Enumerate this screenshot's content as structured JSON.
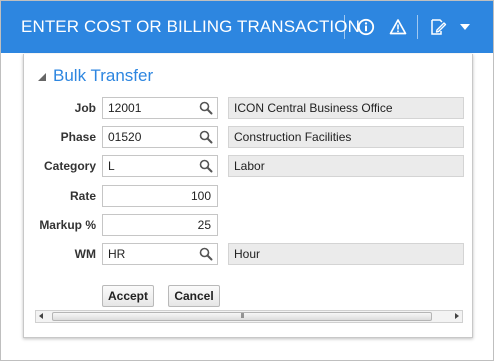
{
  "window": {
    "title": "ENTER COST OR BILLING TRANSACTION",
    "accent_color": "#2d86e0",
    "toolbar_icons": [
      "info-icon",
      "warning-icon",
      "edit-icon",
      "chevron-down-icon"
    ]
  },
  "section": {
    "title": "Bulk Transfer",
    "expanded": true
  },
  "fields": {
    "job": {
      "label": "Job",
      "value": "12001",
      "description": "ICON Central Business Office"
    },
    "phase": {
      "label": "Phase",
      "value": "01520",
      "description": "Construction Facilities"
    },
    "category": {
      "label": "Category",
      "value": "L",
      "description": "Labor"
    },
    "rate": {
      "label": "Rate",
      "value": "100"
    },
    "markup": {
      "label": "Markup %",
      "value": "25"
    },
    "wm": {
      "label": "WM",
      "value": "HR",
      "description": "Hour"
    }
  },
  "buttons": {
    "accept": "Accept",
    "cancel": "Cancel"
  },
  "scrollbar": {
    "grip": "III"
  }
}
